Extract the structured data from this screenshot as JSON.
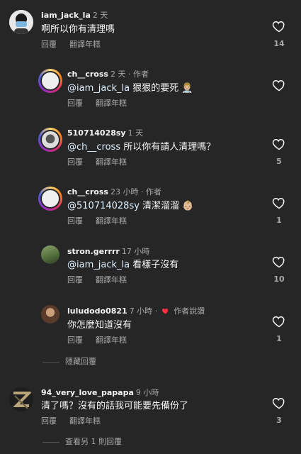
{
  "comments": [
    {
      "username": "iam_jack_la",
      "time": "2 天",
      "text": "啊所以你有清理嗎",
      "reply": "回覆",
      "translate": "翻譯年糕",
      "likes": "14"
    },
    {
      "username": "ch__cross",
      "time": "2 天 · 作者",
      "mention": "@iam_jack_la",
      "text": " 狠狠的要死 👨🏼‍⚕️",
      "reply": "回覆",
      "translate": "翻譯年糕",
      "likes": ""
    },
    {
      "username": "510714028sy",
      "time": "1 天",
      "mention": "@ch__cross",
      "text": " 所以你有請人清理嗎？",
      "reply": "回覆",
      "translate": "翻譯年糕",
      "likes": "5"
    },
    {
      "username": "ch__cross",
      "time": "23 小時 · 作者",
      "mention": "@510714028sy",
      "text": " 清潔溜溜 👶🏼",
      "reply": "回覆",
      "translate": "翻譯年糕",
      "likes": "1"
    },
    {
      "username": "stron.gerrrr",
      "time": "17 小時",
      "mention": "@iam_jack_la",
      "text": "  看樣子沒有",
      "reply": "回覆",
      "translate": "翻譯年糕",
      "likes": "10"
    },
    {
      "username": "luludodo0821",
      "time": "7 小時 ·",
      "author_liked": "作者說讚",
      "text": "你怎麼知道沒有",
      "reply": "回覆",
      "translate": "翻譯年糕",
      "likes": "1"
    },
    {
      "username": "94_very_love_papapa",
      "time": "9 小時",
      "text": "清了嗎？沒有的話我可能要先備份了",
      "reply": "回覆",
      "translate": "翻譯年糕",
      "likes": "3"
    }
  ],
  "hide_replies": "隱藏回覆",
  "view_more": "查看另 1 則回覆"
}
